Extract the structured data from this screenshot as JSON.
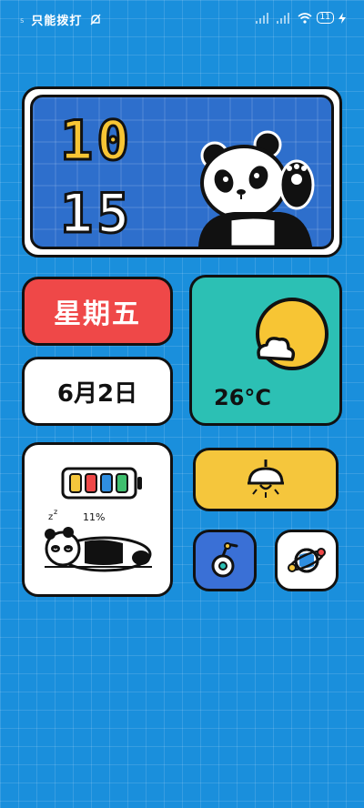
{
  "status_bar": {
    "sim_indicator": "₅",
    "carrier": "只能拨打",
    "battery": "11"
  },
  "clock": {
    "hour": "10",
    "minute": "15"
  },
  "weekday": "星期五",
  "date": "6月2日",
  "weather": {
    "temperature": "26°C",
    "icon": "sun-cloud-icon"
  },
  "battery_widget": {
    "percent": "11%",
    "colors": [
      "#f5c63c",
      "#ef4848",
      "#2f8ee0",
      "#3fbf6e"
    ]
  },
  "colors": {
    "background": "#1a8fdc",
    "red": "#ef4848",
    "teal": "#2cc0b4",
    "yellow": "#f5c63c",
    "blue": "#3a70d6"
  }
}
